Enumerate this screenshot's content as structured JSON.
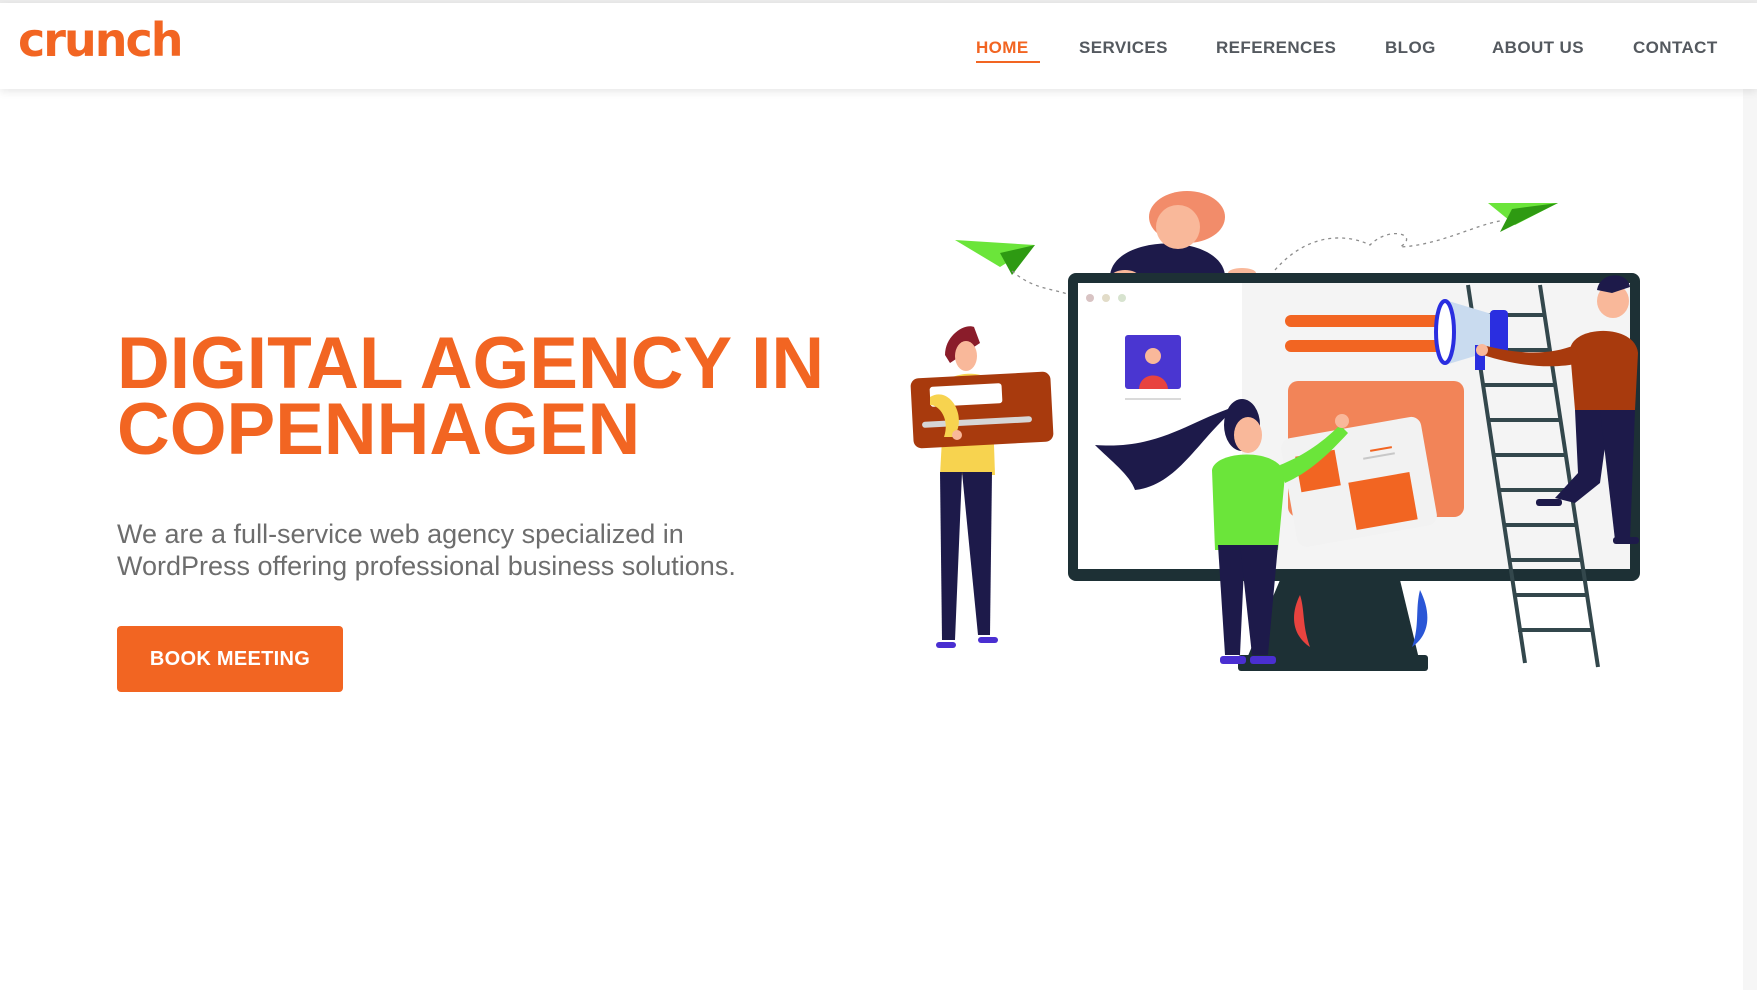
{
  "header": {
    "logo_text": "crunch",
    "nav": [
      {
        "label": "HOME",
        "active": true
      },
      {
        "label": "SERVICES",
        "active": false
      },
      {
        "label": "REFERENCES",
        "active": false
      },
      {
        "label": "BLOG",
        "active": false
      },
      {
        "label": "ABOUT US",
        "active": false
      },
      {
        "label": "CONTACT",
        "active": false
      }
    ]
  },
  "hero": {
    "title_line1": "DIGITAL AGENCY IN",
    "title_line2": "COPENHAGEN",
    "description_line1": "We are a full-service web agency specialized in",
    "description_line2": "WordPress offering professional business solutions.",
    "cta_label": "BOOK MEETING"
  },
  "colors": {
    "brand_orange": "#f26522",
    "nav_text": "#54595f",
    "body_text": "#6d6d6d",
    "monitor_dark": "#1d3035",
    "plane_green": "#6be53a"
  },
  "illustration": {
    "icons": [
      "paper-plane-icon",
      "megaphone-icon",
      "ladder-icon",
      "monitor-icon"
    ]
  }
}
